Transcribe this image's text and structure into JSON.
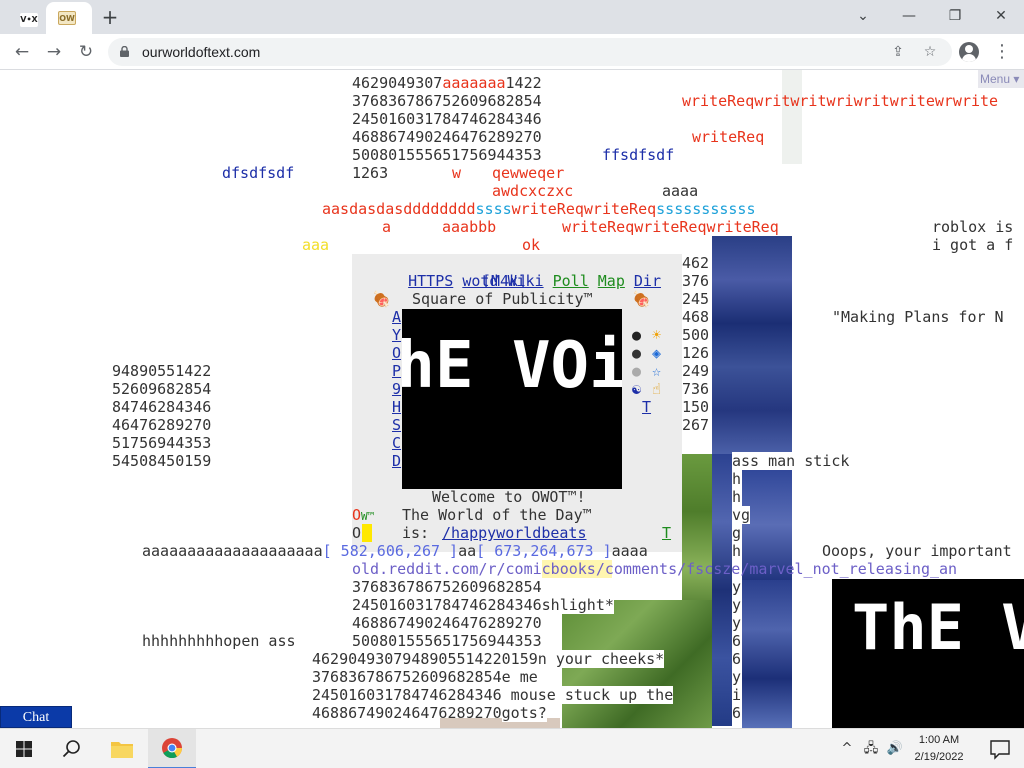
{
  "browser": {
    "tab_inactive_favicon": "V•X",
    "tab_active_favicon": "OW",
    "new_tab_label": "+",
    "url": "ourworldoftext.com",
    "window_controls": {
      "dropdown": "⌄",
      "minimize": "—",
      "restore": "❐",
      "close": "✕"
    },
    "nav": {
      "back": "←",
      "forward": "→",
      "reload": "↻"
    },
    "omni_icons": {
      "share": "⇪",
      "bookmark": "☆"
    },
    "menu_icon": "⋮"
  },
  "world": {
    "menu_label": "Menu ▾",
    "chat_label": "Chat",
    "lines": {
      "l1": "4629049307",
      "l1_red": "aaaaaaa",
      "l1_b": "1422",
      "l2": "376836786752609682854",
      "l2_red": "writeReqwritwritwriwritwritewrwrite",
      "l3": "245016031784746284346",
      "l4": "468867490246476289270",
      "l4_red": "writeReq",
      "l5": "500801555651756944353",
      "l5_blue": "ffsdfsdf",
      "l6_blue": "dfsdfsdf",
      "l6": "1263",
      "l6_red_w": "w",
      "l6_red": "qewweqer",
      "l7_red": "awdcxczxc",
      "l7": "aaaa",
      "l8_red1": "aasdasdasdddddddd",
      "l8_cyan1": "ssss",
      "l8_red2": "writeReqwriteReq",
      "l8_cyan2": "sssssssssss",
      "l9_red_a": "a",
      "l9_red_b": "aaabbb",
      "l9_red_c": "writeReqwriteReqwriteReq",
      "roblox": "roblox is",
      "gota": "i got a f",
      "aaa_yellow": "aaa",
      "ok_red": "ok",
      "making": "\"Making Plans for N",
      "col_right_1": "462",
      "col_right_2": "376",
      "col_right_3": "245",
      "col_right_4": "468",
      "col_right_5": "500",
      "col_right_6": "126",
      "col_right_7": "249",
      "col_right_8": "736",
      "col_right_9": "150",
      "col_right_10": "267",
      "left_1": "94890551422",
      "left_2": "52609682854",
      "left_3": "84746284346",
      "left_4": "46476289270",
      "left_5": "51756944353",
      "left_6": "54508450159",
      "ass_man": "ass man stick",
      "aaaa_long": "aaaaaaaaaaaaaaaaaaaa",
      "coord1": "[ 582,606,267 ]",
      "aa": "aa",
      "coord2": "[ 673,264,673 ]",
      "aaaa": "aaaa",
      "ooops": "Ooops, your important",
      "reddit": "old.reddit.com/r/comicbooks/comments/fscsze/marvel_not_releasing_an",
      "r1": "376836786752609682854",
      "r2": "245016031784746284346",
      "r2b": "shlight*",
      "r3": "468867490246476289270",
      "hhh": "hhhhhhhhhopen ass",
      "r4": "500801555651756944353",
      "r5": "4629049307948905514220159",
      "r5b": "n your cheeks*",
      "r6": "376836786752609682854",
      "r6b": "e me",
      "r7": "245016031784746284346",
      "r7b": " mouse stuck up the",
      "r8": "468867490246476289270",
      "r8b": "gots?",
      "col_letters": [
        "h",
        "h",
        "vg",
        "g",
        "h"
      ],
      "col_letters2": [
        "y",
        "y",
        "y",
        "6",
        "6",
        "y",
        "i",
        "6"
      ]
    },
    "sop": {
      "links": [
        {
          "label": "HTTPS",
          "style": "link"
        },
        {
          "label": "wotd",
          "style": "link"
        },
        {
          "label": "Wiki",
          "style": "link"
        },
        {
          "label": "Poll",
          "style": "green"
        },
        {
          "label": "Map",
          "style": "green"
        },
        {
          "label": "Dir",
          "style": "link"
        }
      ],
      "m4k": "[M4k]",
      "title": "Square of Publicity™",
      "left_letters": [
        "A",
        "Y",
        "O",
        "P",
        "9",
        "H",
        "S",
        "C",
        "D"
      ],
      "right_symbols": [
        "●",
        "☀",
        "●",
        "◈",
        "●",
        "☆",
        "☯",
        "☝",
        "T"
      ],
      "logo_text": "ThE VOiD",
      "welcome": "Welcome to OWOT™!",
      "wotd_prefix": "The World of the Day™",
      "is_label": "is:",
      "wotd_link": "/happyworldbeats",
      "ow_label": "OW™",
      "o_label": "O",
      "t_label": "T"
    }
  },
  "taskbar": {
    "time": "1:00 AM",
    "date": "2/19/2022",
    "tray_icons": {
      "chevron": "^",
      "network": "🖧",
      "volume": "🔊"
    }
  },
  "colors": {
    "accent_red": "#e8341c",
    "accent_blue": "#1d2fa8",
    "chat_bg": "#0b3aa8"
  }
}
